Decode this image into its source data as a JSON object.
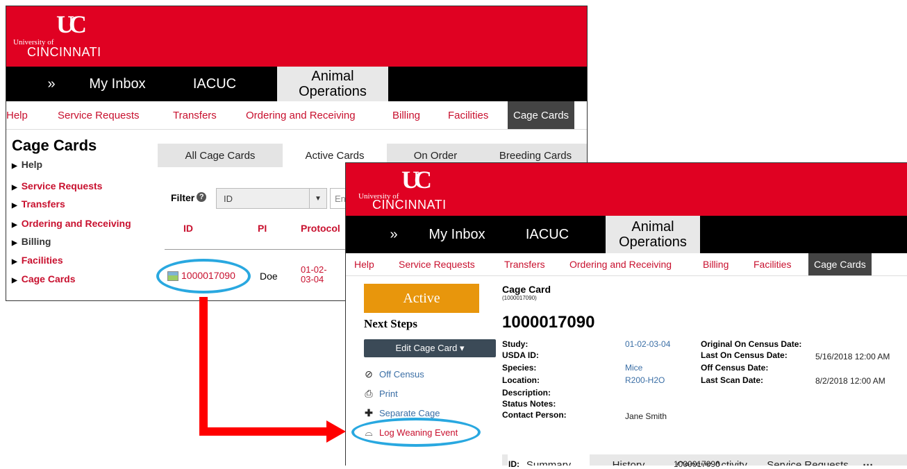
{
  "logo": {
    "university_of": "University of",
    "cincinnati": "CINCINNATI"
  },
  "main_nav": {
    "expand": "»",
    "my_inbox": "My Inbox",
    "iacuc": "IACUC",
    "animal_operations": "Animal Operations"
  },
  "sub_nav": {
    "help": "Help",
    "service_requests": "Service Requests",
    "transfers": "Transfers",
    "ordering": "Ordering and Receiving",
    "billing": "Billing",
    "facilities": "Facilities",
    "cage_cards": "Cage Cards"
  },
  "cage_cards_page": {
    "title": "Cage Cards",
    "side_links": [
      "Help",
      "Service Requests",
      "Transfers",
      "Ordering and Receiving",
      "Billing",
      "Facilities",
      "Cage Cards"
    ],
    "tabs": [
      "All Cage Cards",
      "Active Cards",
      "On Order",
      "Breeding Cards"
    ],
    "active_tab": "Active Cards",
    "filter_label": "Filter",
    "filter_select": "ID",
    "filter_input_placeholder": "Ent",
    "columns": {
      "id": "ID",
      "pi": "PI",
      "protocol": "Protocol"
    },
    "row": {
      "id": "1000017090",
      "pi": "Doe",
      "protocol_line1": "01-02-",
      "protocol_line2": "03-04"
    }
  },
  "cage_card_detail": {
    "status": "Active",
    "next_steps": "Next Steps",
    "edit_button": "Edit Cage Card ▾",
    "actions": {
      "off_census": "Off Census",
      "print": "Print",
      "separate_cage": "Separate Cage",
      "log_weaning": "Log Weaning Event"
    },
    "title": "Cage Card",
    "subtitle": "(1000017090)",
    "number": "1000017090",
    "left_fields": {
      "study": {
        "label": "Study:",
        "value": "01-02-03-04"
      },
      "usda_id": {
        "label": "USDA ID:",
        "value": ""
      },
      "species": {
        "label": "Species:",
        "value": "Mice"
      },
      "location": {
        "label": "Location:",
        "value": "R200-H2O"
      },
      "description": {
        "label": "Description:",
        "value": ""
      },
      "status_notes": {
        "label": "Status Notes:",
        "value": ""
      },
      "contact_person": {
        "label": "Contact Person:",
        "value": "Jane Smith"
      }
    },
    "right_fields": {
      "original_on_census": {
        "label": "Original On Census Date:",
        "value": ""
      },
      "last_on_census": {
        "label": "Last On Census Date:",
        "value": "5/16/2018 12:00 AM"
      },
      "off_census": {
        "label": "Off Census Date:",
        "value": ""
      },
      "last_scan": {
        "label": "Last Scan Date:",
        "value": "8/2/2018 12:00 AM"
      }
    },
    "tabs": [
      "Summary",
      "History",
      "Census Activity",
      "Service Requests",
      "···"
    ],
    "bottom_label": "ID:",
    "bottom_value": "1000017090"
  },
  "colors": {
    "uc_red": "#e00122",
    "link_red": "#c8102e",
    "status_orange": "#e8960c",
    "highlight_blue": "#29a8e0",
    "arrow_red": "#ff0000"
  }
}
